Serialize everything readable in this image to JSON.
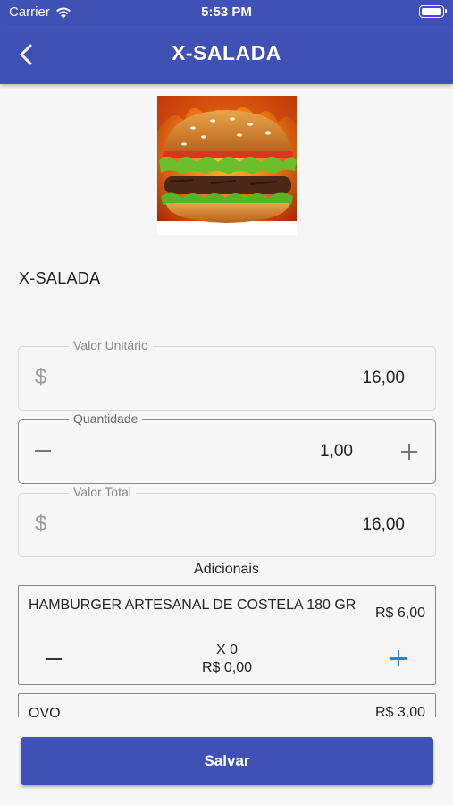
{
  "status_bar": {
    "carrier": "Carrier",
    "time": "5:53 PM"
  },
  "header": {
    "title": "X-SALADA",
    "back_icon": "chevron-left-icon"
  },
  "product": {
    "name": "X-SALADA",
    "image": "burger-photo"
  },
  "fields": {
    "unit_price": {
      "legend": "Valor Unitário",
      "prefix": "$",
      "value": "16,00"
    },
    "quantity": {
      "legend": "Quantidade",
      "value": "1,00"
    },
    "total": {
      "legend": "Valor Total",
      "prefix": "$",
      "value": "16,00"
    }
  },
  "addons": {
    "title": "Adicionais",
    "items": [
      {
        "name": "HAMBURGER ARTESANAL DE COSTELA 180 GR",
        "price": "R$ 6,00",
        "qty": "X 0",
        "subtotal": "R$ 0,00"
      },
      {
        "name": "OVO",
        "price": "R$ 3,00"
      }
    ]
  },
  "actions": {
    "save_label": "Salvar"
  },
  "colors": {
    "primary": "#3f51b5",
    "accent_plus": "#2b7de9",
    "background": "#f6f6f6"
  }
}
